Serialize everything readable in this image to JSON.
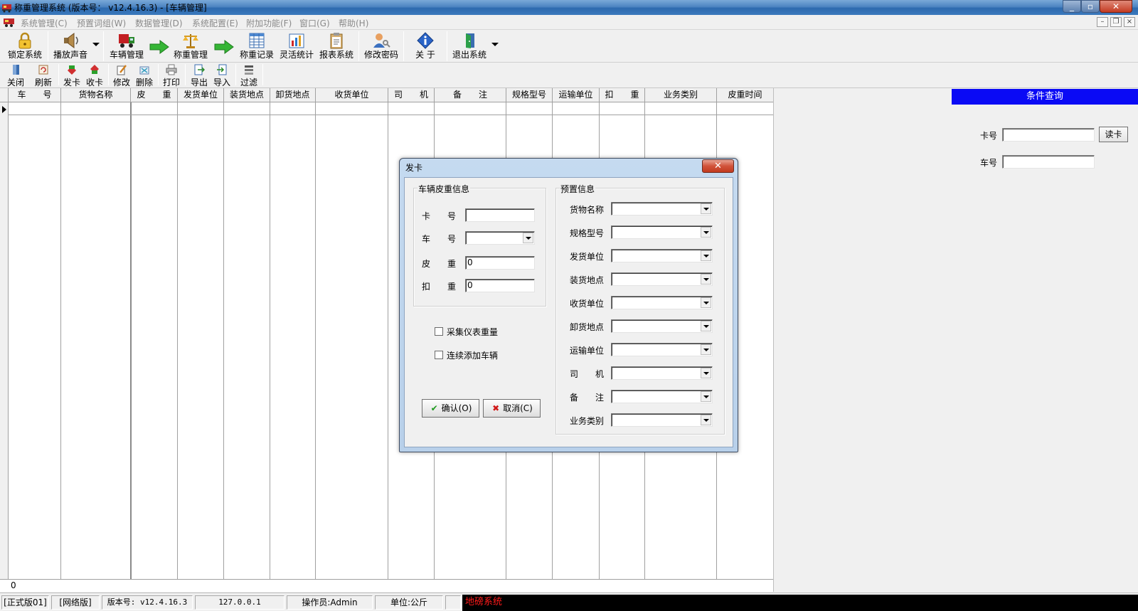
{
  "window": {
    "title": "称重管理系统 (版本号： v12.4.16.3) - [车辆管理]",
    "min": "_",
    "max": "▫",
    "close": "✕"
  },
  "menu": {
    "items": [
      "系统管理(C)",
      "预置词组(W)",
      "数据管理(D)",
      "系统配置(E)",
      "附加功能(F)",
      "窗口(G)",
      "帮助(H)"
    ],
    "mdi": {
      "min": "–",
      "restore": "❐",
      "close": "×"
    }
  },
  "toolbar": {
    "lock": "锁定系统",
    "sound": "播放声音",
    "vehicle": "车辆管理",
    "weigh": "称重管理",
    "records": "称重记录",
    "stats": "灵活统计",
    "report": "报表系统",
    "password": "修改密码",
    "about": "关 于",
    "exit": "退出系统"
  },
  "toolbar2": {
    "close": "关闭",
    "refresh": "刷新",
    "issue": "发卡",
    "collect": "收卡",
    "edit": "修改",
    "delete": "删除",
    "print": "打印",
    "export": "导出",
    "import": "导入",
    "filter": "过滤"
  },
  "grid": {
    "columns": [
      "车　　号",
      "货物名称",
      "皮　　重",
      "发货单位",
      "装货地点",
      "卸货地点",
      "收货单位",
      "司　　机",
      "备　　注",
      "规格型号",
      "运输单位",
      "扣　　重",
      "业务类别",
      "皮重时间"
    ],
    "footer_count": "0"
  },
  "query_panel": {
    "title": "条件查询",
    "card_label": "卡号",
    "plate_label": "车号",
    "read_card": "读卡"
  },
  "dialog": {
    "title": "发卡",
    "close": "✕",
    "group1_title": "车辆皮重信息",
    "card_label": "卡　　号",
    "plate_label": "车　　号",
    "tare_label": "皮　　重",
    "deduct_label": "扣　　重",
    "tare_value": "0",
    "deduct_value": "0",
    "checkbox1": "采集仪表重量",
    "checkbox2": "连续添加车辆",
    "confirm": "确认(O)",
    "cancel": "取消(C)",
    "group2_title": "预置信息",
    "preset_labels": [
      "货物名称",
      "规格型号",
      "发货单位",
      "装货地点",
      "收货单位",
      "卸货地点",
      "运输单位",
      "司　　机",
      "备　　注",
      "业务类别"
    ]
  },
  "statusbar": {
    "edition": "[正式版01]",
    "network": "[网络版]",
    "version": "版本号: v12.4.16.3",
    "ip": "127.0.0.1",
    "operator": "操作员:Admin",
    "unit": "单位:公斤",
    "marquee": "地磅系统"
  }
}
